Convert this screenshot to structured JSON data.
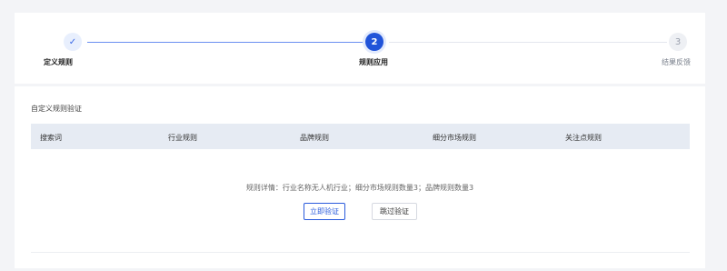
{
  "steps": [
    {
      "label": "定义规则",
      "marker": "✓",
      "state": "done"
    },
    {
      "label": "规则应用",
      "marker": "2",
      "state": "current"
    },
    {
      "label": "结果反馈",
      "marker": "3",
      "state": "pending"
    }
  ],
  "section": {
    "title": "自定义规则验证"
  },
  "table": {
    "headers": [
      "搜索词",
      "行业规则",
      "品牌规则",
      "细分市场规则",
      "关注点规则"
    ]
  },
  "detail_text": "规则详情：行业名称无人机行业；细分市场规则数量3；品牌规则数量3",
  "buttons": {
    "verify_now": "立即验证",
    "skip_verify": "跳过验证"
  },
  "colors": {
    "accent": "#2154d9",
    "line_done": "#6a8ff0",
    "header_bg": "#e6ebf3"
  }
}
